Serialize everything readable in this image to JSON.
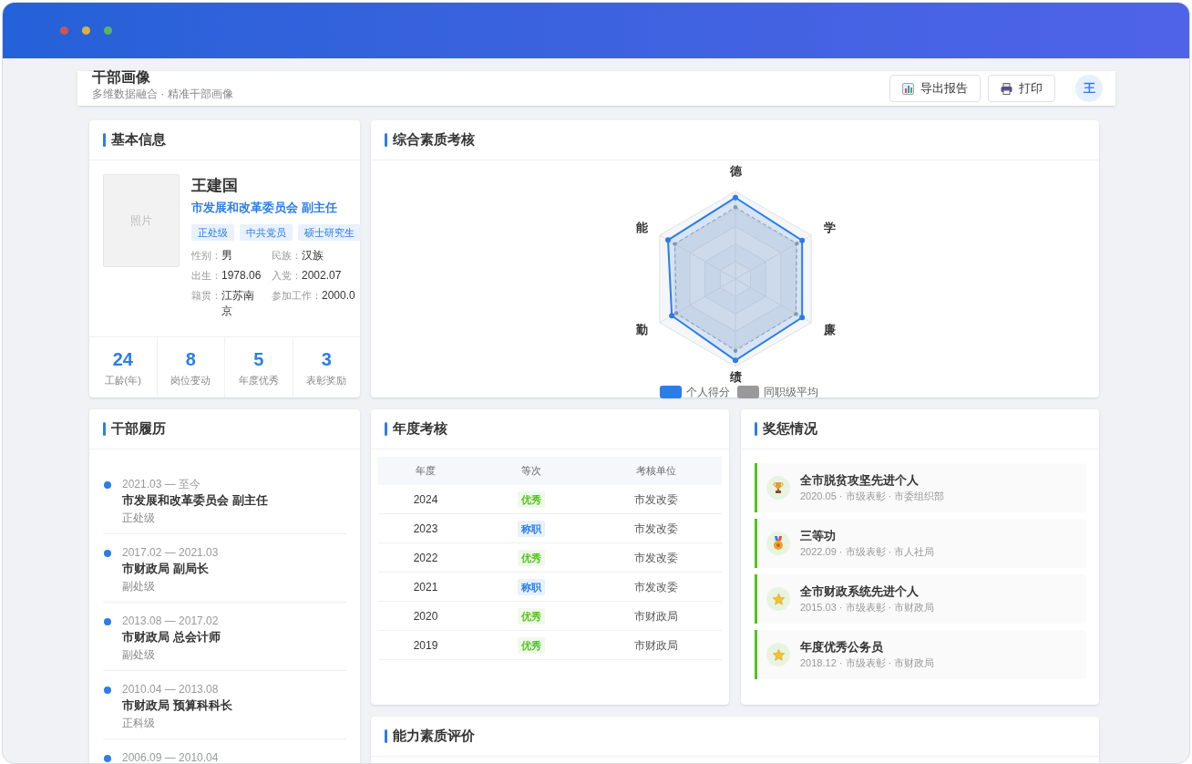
{
  "header": {
    "title": "干部画像",
    "subtitle": "多维数据融合 · 精准干部画像",
    "buttons": [
      "导出报告",
      "打印"
    ],
    "avatar": "王"
  },
  "basic_info": {
    "title": "基本信息",
    "photo_label": "照片",
    "name": "王建国",
    "position": "市发展和改革委员会 副主任",
    "tags": [
      "正处级",
      "中共党员",
      "硕士研究生"
    ],
    "fields": [
      {
        "label": "性别：",
        "value": "男"
      },
      {
        "label": "民族：",
        "value": "汉族"
      },
      {
        "label": "出生：",
        "value": "1978.06"
      },
      {
        "label": "入党：",
        "value": "2002.07"
      },
      {
        "label": "籍贯：",
        "value": "江苏南京"
      },
      {
        "label": "参加工作：",
        "value": "2000.0"
      }
    ],
    "stats": [
      {
        "value": "24",
        "label": "工龄(年)"
      },
      {
        "value": "8",
        "label": "岗位变动"
      },
      {
        "value": "5",
        "label": "年度优秀"
      },
      {
        "value": "3",
        "label": "表彰奖励"
      }
    ]
  },
  "quality": {
    "title": "综合素质考核",
    "axes": [
      "德",
      "学",
      "廉",
      "绩",
      "勤",
      "能"
    ],
    "legend": [
      {
        "label": "个人得分",
        "color": "#2b7de9"
      },
      {
        "label": "同职级平均",
        "color": "#999999"
      }
    ]
  },
  "career": {
    "title": "干部履历",
    "items": [
      {
        "period": "2021.03 — 至今",
        "position": "市发展和改革委员会 副主任",
        "level": "正处级"
      },
      {
        "period": "2017.02 — 2021.03",
        "position": "市财政局 副局长",
        "level": "副处级"
      },
      {
        "period": "2013.08 — 2017.02",
        "position": "市财政局 总会计师",
        "level": "副处级"
      },
      {
        "period": "2010.04 — 2013.08",
        "position": "市财政局 预算科科长",
        "level": "正科级"
      },
      {
        "period": "2006.09 — 2010.04"
      }
    ]
  },
  "annual": {
    "title": "年度考核",
    "columns": [
      "年度",
      "等次",
      "考核单位"
    ],
    "rows": [
      {
        "year": "2024",
        "grade": "优秀",
        "kind": "excellent",
        "unit": "市发改委"
      },
      {
        "year": "2023",
        "grade": "称职",
        "kind": "competent",
        "unit": "市发改委"
      },
      {
        "year": "2022",
        "grade": "优秀",
        "kind": "excellent",
        "unit": "市发改委"
      },
      {
        "year": "2021",
        "grade": "称职",
        "kind": "competent",
        "unit": "市发改委"
      },
      {
        "year": "2020",
        "grade": "优秀",
        "kind": "excellent",
        "unit": "市财政局"
      },
      {
        "year": "2019",
        "grade": "优秀",
        "kind": "excellent",
        "unit": "市财政局"
      }
    ]
  },
  "awards": {
    "title": "奖惩情况",
    "items": [
      {
        "title": "全市脱贫攻坚先进个人",
        "meta": "2020.05 · 市级表彰 · 市委组织部",
        "kind": "trophy"
      },
      {
        "title": "三等功",
        "meta": "2022.09 · 市级表彰 · 市人社局",
        "kind": "medal"
      },
      {
        "title": "全市财政系统先进个人",
        "meta": "2015.03 · 市级表彰 · 市财政局",
        "kind": "star"
      },
      {
        "title": "年度优秀公务员",
        "meta": "2018.12 · 市级表彰 · 市财政局",
        "kind": "star"
      }
    ]
  },
  "ability": {
    "title": "能力素质评价"
  }
}
